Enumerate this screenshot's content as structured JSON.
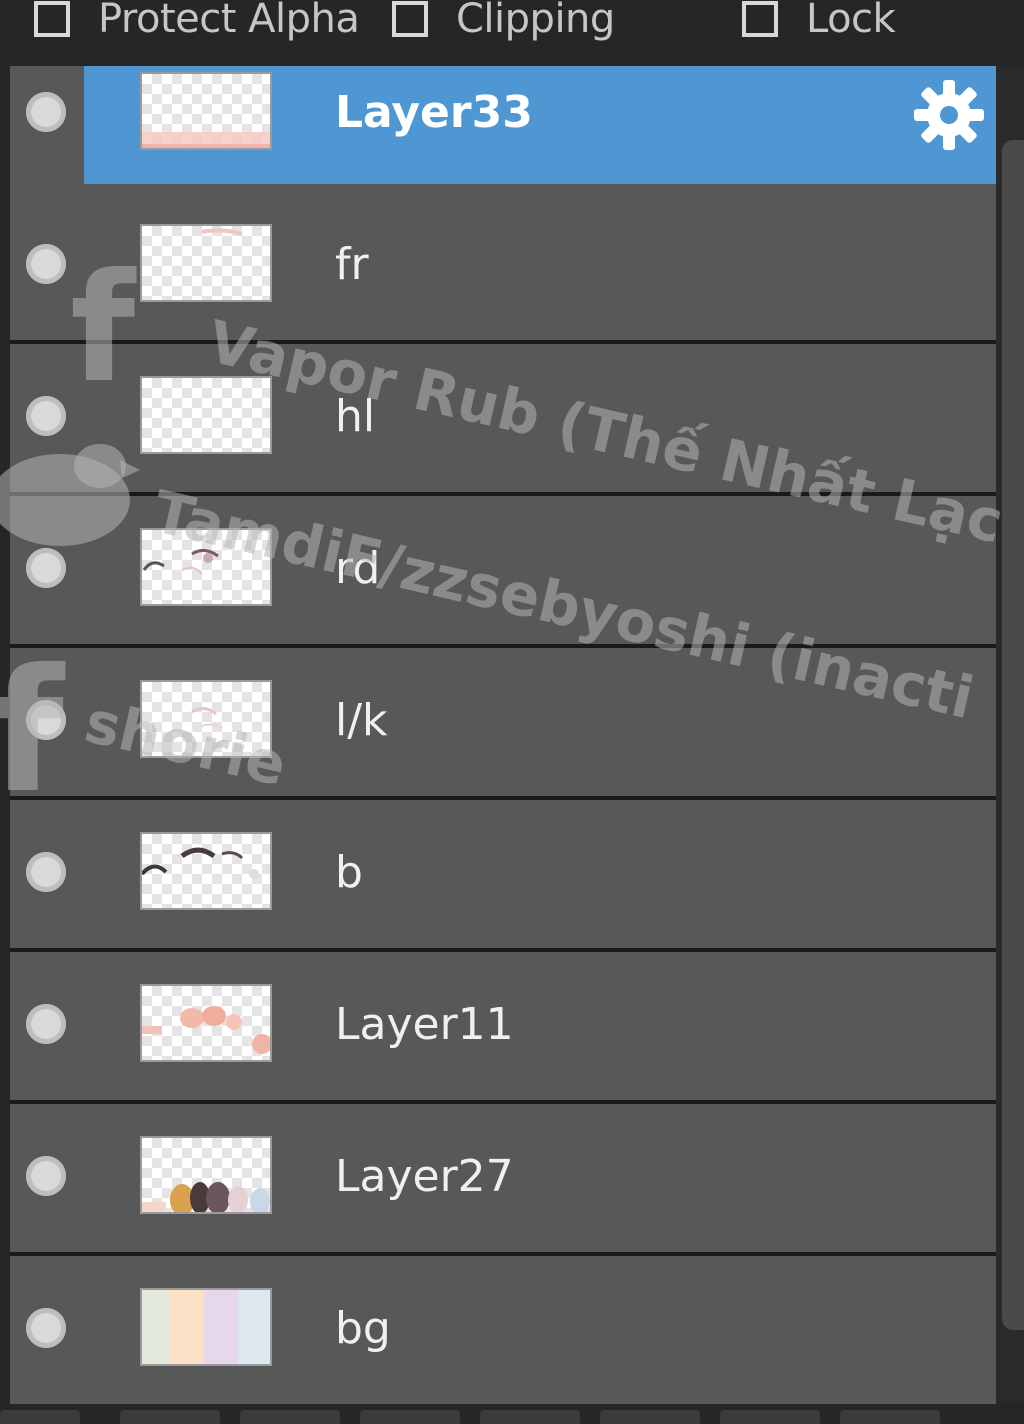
{
  "options": {
    "protect_alpha": {
      "label": "Protect Alpha",
      "checked": false
    },
    "clipping": {
      "label": "Clipping",
      "checked": false
    },
    "lock": {
      "label": "Lock",
      "checked": false
    }
  },
  "layers": [
    {
      "name": "Layer33",
      "selected": true,
      "thumb_icon": "thumb-pink-edge"
    },
    {
      "name": "fr",
      "selected": false,
      "thumb_icon": "thumb-faint-top"
    },
    {
      "name": "hl",
      "selected": false,
      "thumb_icon": "thumb-empty"
    },
    {
      "name": "rd",
      "selected": false,
      "thumb_icon": "thumb-sketch"
    },
    {
      "name": "l/k",
      "selected": false,
      "thumb_icon": "thumb-faint-sketch"
    },
    {
      "name": "b",
      "selected": false,
      "thumb_icon": "thumb-dark-sketch"
    },
    {
      "name": "Layer11",
      "selected": false,
      "thumb_icon": "thumb-peach-shapes"
    },
    {
      "name": "Layer27",
      "selected": false,
      "thumb_icon": "thumb-figures"
    },
    {
      "name": "bg",
      "selected": false,
      "thumb_icon": "thumb-pastel-stripes"
    }
  ],
  "icons": {
    "settings": "gear-icon",
    "visibility": "visibility-dot-icon",
    "checkbox": "checkbox-icon"
  },
  "colors": {
    "selection": "#4f97d2",
    "row_bg": "#585858",
    "panel_bg": "#262626"
  },
  "watermark": {
    "line1": "Vapor Rub (Thế Nhất Lạc",
    "line2": "TamdiF/zzsebyoshi (inacti",
    "line3": "shorie"
  }
}
